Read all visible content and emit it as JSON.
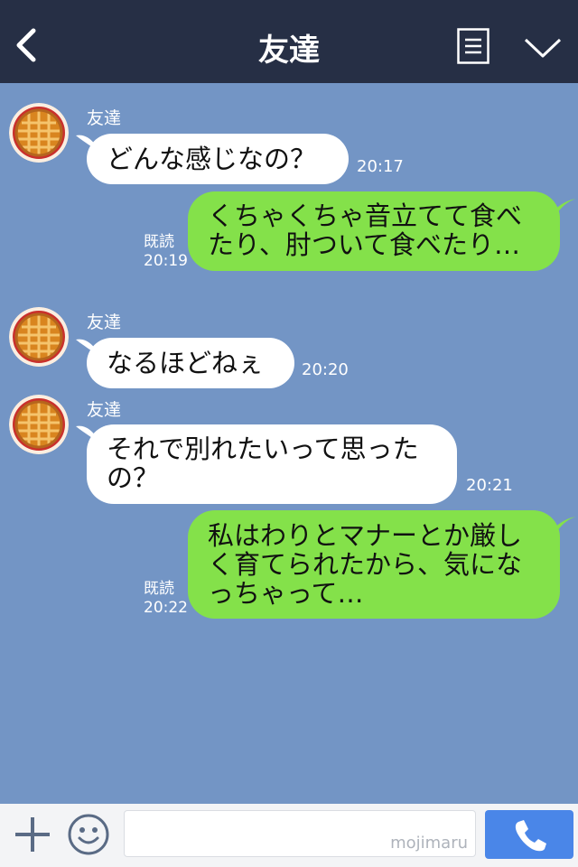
{
  "header": {
    "title": "友達",
    "icons": {
      "back": "chevron-left-icon",
      "menu": "list-menu-icon",
      "collapse": "chevron-down-icon"
    }
  },
  "messages": [
    {
      "direction": "incoming",
      "sender": "友達",
      "text": "どんな感じなの？",
      "time": "20:17"
    },
    {
      "direction": "outgoing",
      "read": "既読",
      "text_lines": [
        "くちゃくちゃ音立てて食べ",
        "たり、肘ついて食べたり…"
      ],
      "time": "20:19"
    },
    {
      "direction": "incoming",
      "sender": "友達",
      "text": "なるほどねぇ",
      "time": "20:20"
    },
    {
      "direction": "incoming",
      "sender": "友達",
      "text_lines": [
        "それで別れたいって思った",
        "の？"
      ],
      "time": "20:21"
    },
    {
      "direction": "outgoing",
      "read": "既読",
      "text_lines": [
        "私はわりとマナーとか厳し",
        "く育てられたから、気にな",
        "っちゃって…"
      ],
      "time": "20:22"
    }
  ],
  "input_bar": {
    "watermark": "mojimaru",
    "icons": {
      "add": "plus-icon",
      "sticker": "smiley-icon",
      "call": "phone-icon"
    }
  },
  "colors": {
    "header_bg": "#262f45",
    "chat_bg": "#7395c5",
    "incoming_bubble": "#ffffff",
    "outgoing_bubble": "#84e14a",
    "call_button": "#4a86e8"
  }
}
